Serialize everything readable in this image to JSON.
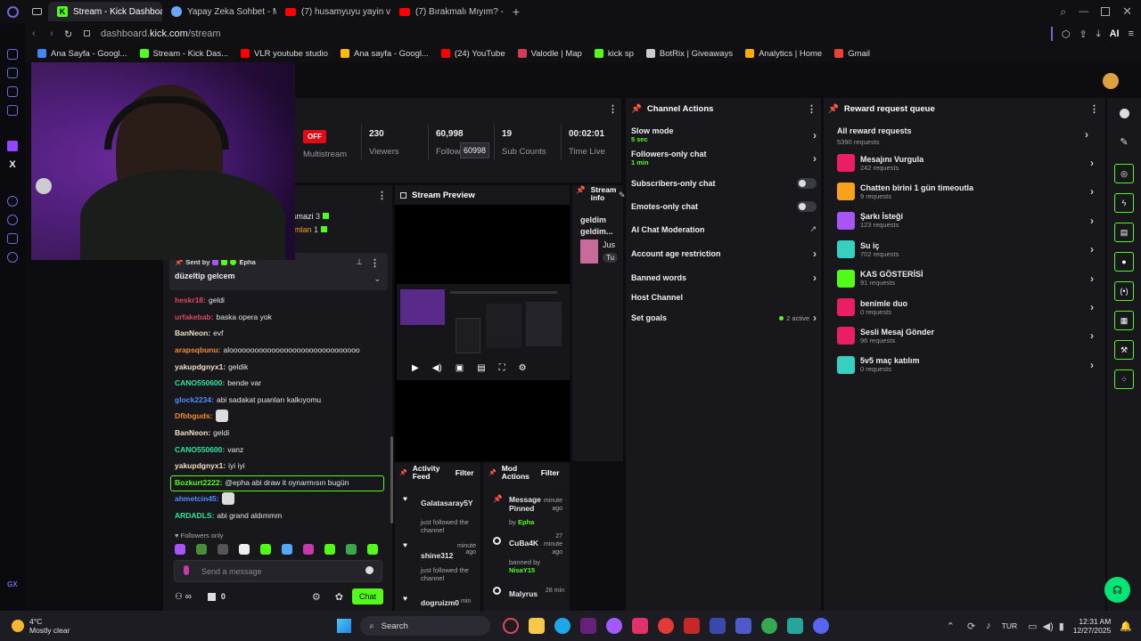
{
  "browser": {
    "tabs": [
      {
        "label": "Stream - Kick Dashboard",
        "icon": "kick-icon",
        "active": true
      },
      {
        "label": "Yapay Zeka Sohbet - Miss",
        "icon": "ai-icon",
        "active": false
      },
      {
        "label": "(7) husamyuyu yayin vakti",
        "icon": "youtube-icon",
        "active": false
      },
      {
        "label": "(7) Bırakmalı Mıyım? - You",
        "icon": "youtube-icon",
        "active": false
      }
    ],
    "url_prefix": "dashboard.",
    "url_domain": "kick.com",
    "url_path": "/stream",
    "ai_label": "AI",
    "bookmarks": [
      {
        "label": "Ana Sayfa - Googl...",
        "color": "#4285f4"
      },
      {
        "label": "Stream - Kick Das...",
        "color": "#53fc18"
      },
      {
        "label": "VLR youtube studio",
        "color": "#ff0000"
      },
      {
        "label": "Ana sayfa - Googl...",
        "color": "#fbbc05"
      },
      {
        "label": "(24) YouTube",
        "color": "#ff0000"
      },
      {
        "label": "Valodle | Map",
        "color": "#d63a5b"
      },
      {
        "label": "kick sp",
        "color": "#53fc18"
      },
      {
        "label": "BotRix | Giveaways",
        "color": "#cccccc"
      },
      {
        "label": "Analytics | Home",
        "color": "#f9ab00"
      },
      {
        "label": "Gmail",
        "color": "#ea4335"
      }
    ]
  },
  "stats": {
    "off_badge": "OFF",
    "multistream_label": "Multistream",
    "viewers_value": "230",
    "viewers_label": "Viewers",
    "followers_value": "60,998",
    "followers_label": "Follow",
    "followers_tooltip": "60998",
    "subs_value": "19",
    "subs_label": "Sub Counts",
    "time_value": "00:02:01",
    "time_label": "Time Live"
  },
  "leaderboard": [
    {
      "name": "smazi",
      "count": "3"
    },
    {
      "name": "imlan",
      "count": "1"
    }
  ],
  "pinned": {
    "sent_by_label": "Sent by",
    "sender": "Epha",
    "message": "düzeltip gelcem"
  },
  "chat": [
    {
      "user": "heskr18",
      "color": "#e0475f",
      "text": "geldi"
    },
    {
      "user": "urfakebab",
      "color": "#e0475f",
      "text": "baska opera yok"
    },
    {
      "user": "BanNeon",
      "color": "#f0e0c0",
      "text": "evf"
    },
    {
      "user": "arapsqbunu",
      "color": "#f08c2a",
      "text": "alooooooooooooooooooooooooooooooo"
    },
    {
      "user": "yakupdgnyx1",
      "color": "#f0e0c0",
      "text": "geldik"
    },
    {
      "user": "CANO550600",
      "color": "#2de3a0",
      "text": "bende var"
    },
    {
      "user": "glock2234",
      "color": "#4f8dff",
      "text": "abi sadakat puanları kalkıyomu"
    },
    {
      "user": "Dfbbguds",
      "color": "#f08c2a",
      "text": ""
    },
    {
      "user": "BanNeon",
      "color": "#f0e0c0",
      "text": "geldi"
    },
    {
      "user": "CANO550600",
      "color": "#2de3a0",
      "text": "vanz"
    },
    {
      "user": "yakupdgnyx1",
      "color": "#f0e0c0",
      "text": "iyi iyi"
    },
    {
      "user": "Bozkurt2222",
      "color": "#53fc18",
      "text": "@epha abi draw it oynarmısın bugün"
    },
    {
      "user": "ahmetcin45",
      "color": "#4f8dff",
      "text": ""
    },
    {
      "user": "ARDADLS",
      "color": "#2de3a0",
      "text": "abi grand aldımmm"
    }
  ],
  "chat_input": {
    "followers_only": "Followers only",
    "placeholder": "Send a message",
    "points": "0",
    "chat_button": "Chat"
  },
  "stream_preview": {
    "title": "Stream Preview"
  },
  "stream_info": {
    "title": "Stream info",
    "stream_title": "geldim geldim...",
    "game_short": "Jus",
    "tag_short": "Tu"
  },
  "activity_feed": {
    "title": "Activity Feed",
    "filter": "Filter",
    "items": [
      {
        "user": "Galatasaray5Y",
        "action": "just followed the channel"
      },
      {
        "user": "shine312",
        "time": "minute ago",
        "action": "just followed the channel"
      },
      {
        "user": "dogruizm0",
        "time": "min"
      }
    ]
  },
  "mod_actions": {
    "title": "Mod Actions",
    "filter": "Filter",
    "items": [
      {
        "title": "Message Pinned",
        "time": "minute ago",
        "by_label": "by",
        "by": "Epha"
      },
      {
        "title": "CuBa4K",
        "time": "27 minute ago",
        "by_label": "banned by",
        "by": "NisaY15"
      },
      {
        "title": "Malyrus",
        "time": "28 min"
      }
    ]
  },
  "channel_actions": {
    "title": "Channel Actions",
    "items": [
      {
        "label": "Slow mode",
        "sub": "5 sec",
        "control": "chevron"
      },
      {
        "label": "Followers-only chat",
        "sub": "1 min",
        "control": "chevron"
      },
      {
        "label": "Subscribers-only chat",
        "sub": "",
        "control": "toggle"
      },
      {
        "label": "Emotes-only chat",
        "sub": "",
        "control": "toggle"
      },
      {
        "label": "AI Chat Moderation",
        "sub": "",
        "control": "external"
      },
      {
        "label": "Account age restriction",
        "sub": "",
        "control": "chevron"
      },
      {
        "label": "Banned words",
        "sub": "",
        "control": "chevron"
      },
      {
        "label": "Host Channel",
        "sub": "",
        "control": "none"
      },
      {
        "label": "Set goals",
        "sub": "",
        "control": "chevron",
        "status": "2 active"
      }
    ]
  },
  "reward_queue": {
    "title": "Reward request queue",
    "all_label": "All reward requests",
    "all_count": "5390 requests",
    "items": [
      {
        "name": "Mesajını Vurgula",
        "count": "242 requests",
        "color": "#e91e63"
      },
      {
        "name": "Chatten birini 1 gün timeoutla",
        "count": "9 requests",
        "color": "#f7a21b"
      },
      {
        "name": "Şarkı İsteği",
        "count": "123 requests",
        "color": "#a855f7"
      },
      {
        "name": "Su iç",
        "count": "702 requests",
        "color": "#35d0c0"
      },
      {
        "name": "KAS GÖSTERİSİ",
        "count": "91 requests",
        "color": "#53fc18"
      },
      {
        "name": "benimle duo",
        "count": "0 requests",
        "color": "#e91e63"
      },
      {
        "name": "Sesli Mesaj Gönder",
        "count": "96 requests",
        "color": "#e91e63"
      },
      {
        "name": "5v5 maç katılım",
        "count": "0 requests",
        "color": "#35d0c0"
      }
    ]
  },
  "taskbar": {
    "weather_temp": "4°C",
    "weather_desc": "Mostly clear",
    "search": "Search",
    "lang": "TUR",
    "time": "12:31 AM",
    "date": "12/27/2025"
  }
}
